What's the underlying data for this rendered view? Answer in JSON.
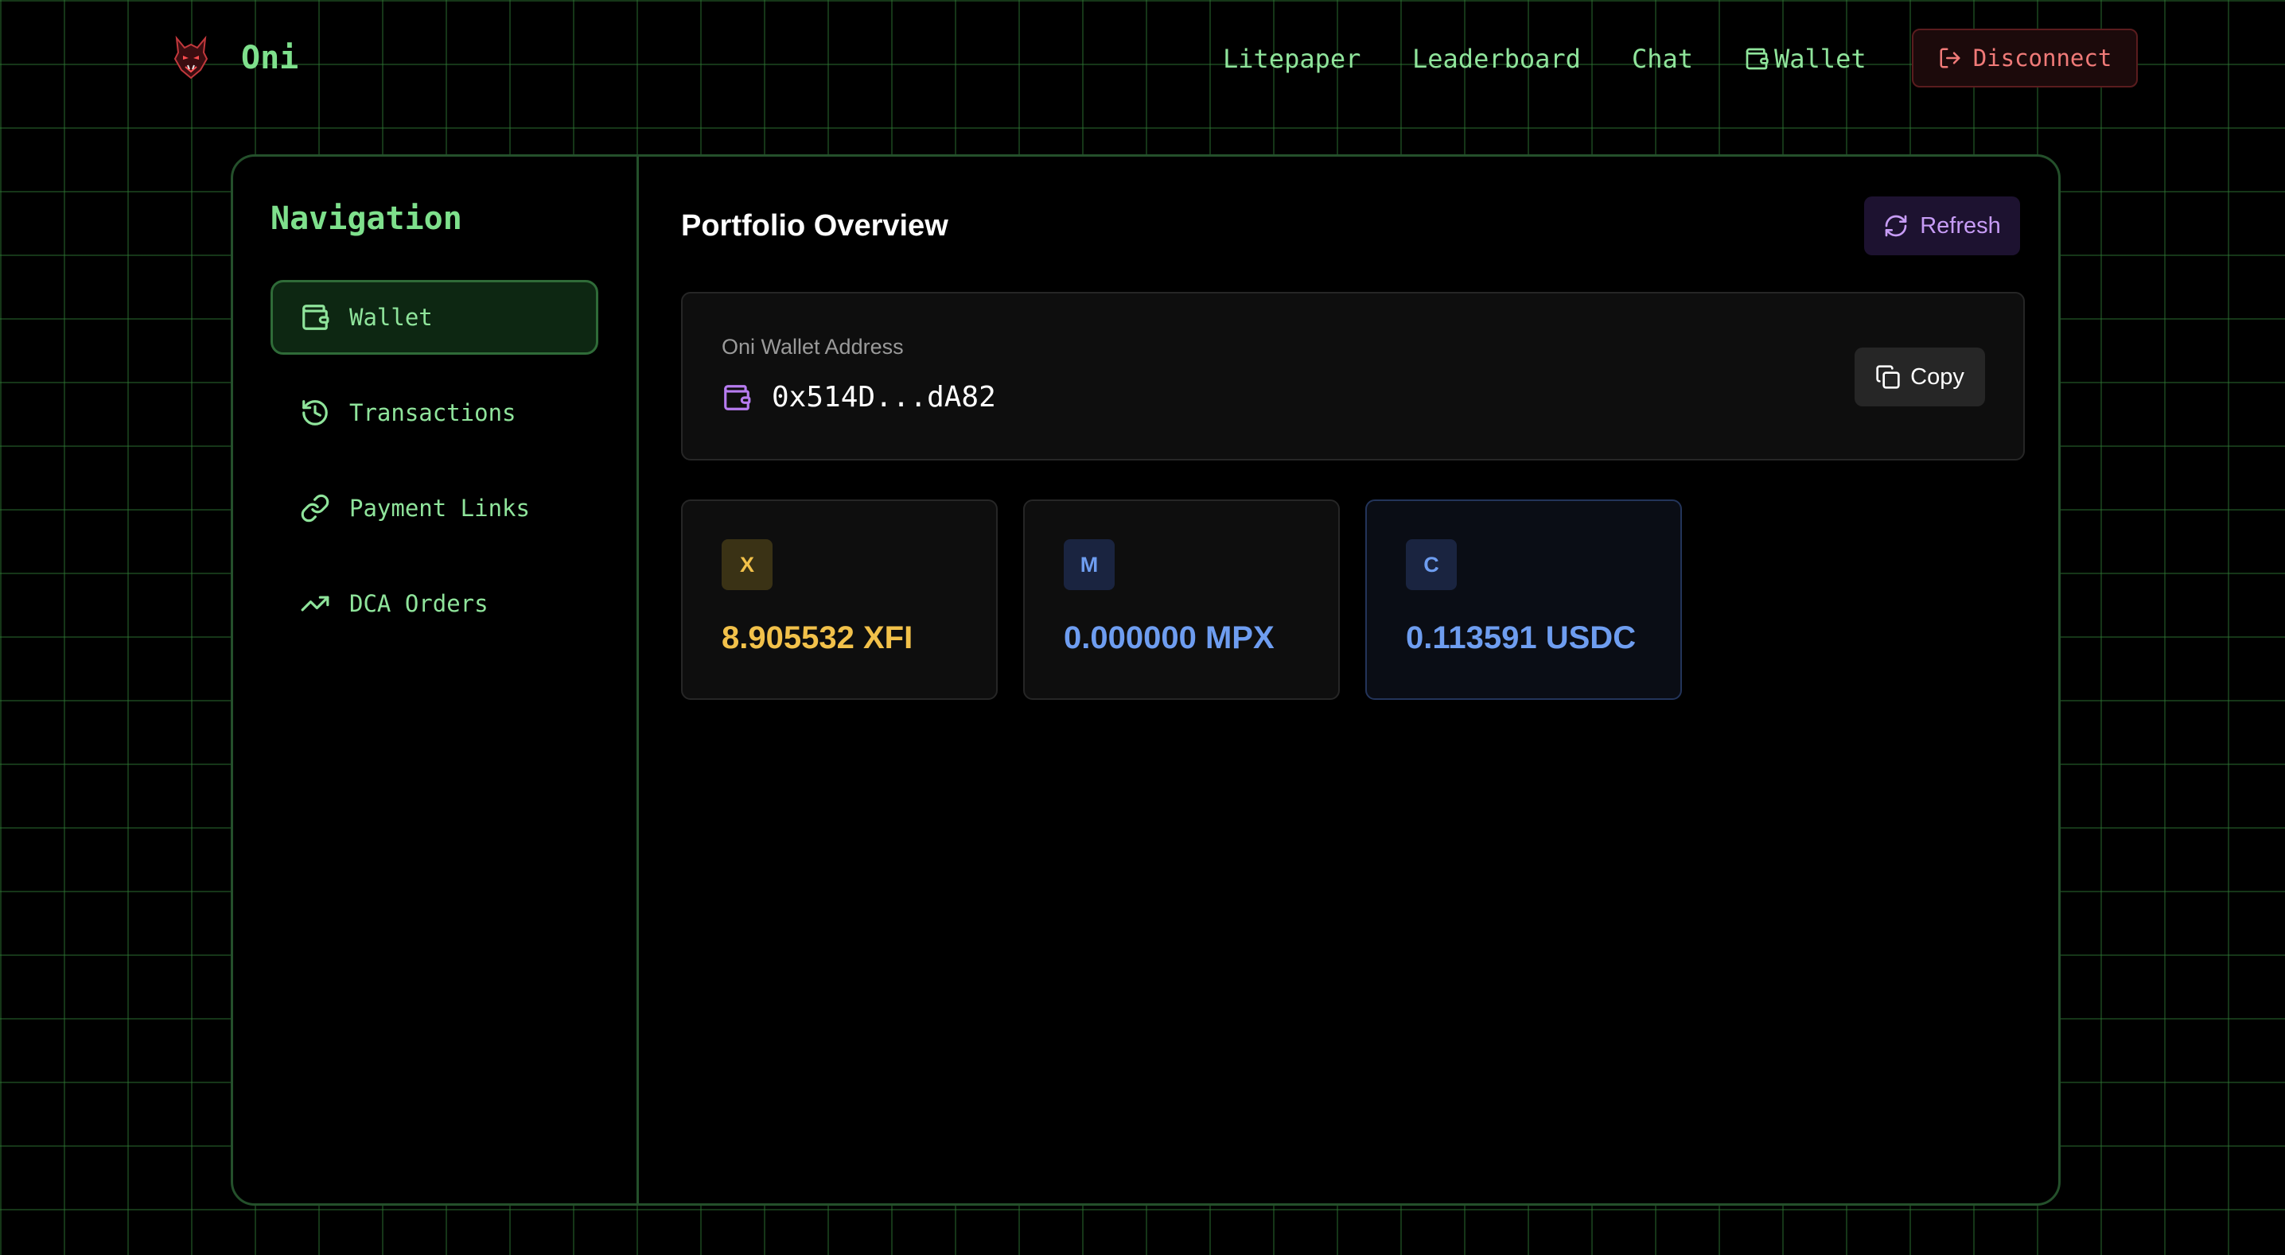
{
  "header": {
    "brand": "Oni",
    "nav": {
      "litepaper": "Litepaper",
      "leaderboard": "Leaderboard",
      "chat": "Chat",
      "wallet": "Wallet"
    },
    "disconnect_label": "Disconnect"
  },
  "sidebar": {
    "title": "Navigation",
    "items": [
      {
        "label": "Wallet",
        "icon": "wallet-icon",
        "active": true
      },
      {
        "label": "Transactions",
        "icon": "history-icon",
        "active": false
      },
      {
        "label": "Payment Links",
        "icon": "link-icon",
        "active": false
      },
      {
        "label": "DCA Orders",
        "icon": "trending-up-icon",
        "active": false
      }
    ]
  },
  "main": {
    "title": "Portfolio Overview",
    "refresh_label": "Refresh",
    "wallet_card": {
      "label": "Oni Wallet Address",
      "address": "0x514D...dA82",
      "copy_label": "Copy"
    },
    "tokens": [
      {
        "badge": "X",
        "amount": "8.905532 XFI",
        "color": "#f2c14a",
        "badge_bg": "#3a3215"
      },
      {
        "badge": "M",
        "amount": "0.000000 MPX",
        "color": "#6e9df0",
        "badge_bg": "#1a2440"
      },
      {
        "badge": "C",
        "amount": "0.113591 USDC",
        "color": "#6e9df0",
        "badge_bg": "#1a2440"
      }
    ]
  },
  "colors": {
    "accent_green": "#7ee08c",
    "grid_green": "#2e7834",
    "danger": "#f07a78",
    "purple": "#c79cf6"
  }
}
